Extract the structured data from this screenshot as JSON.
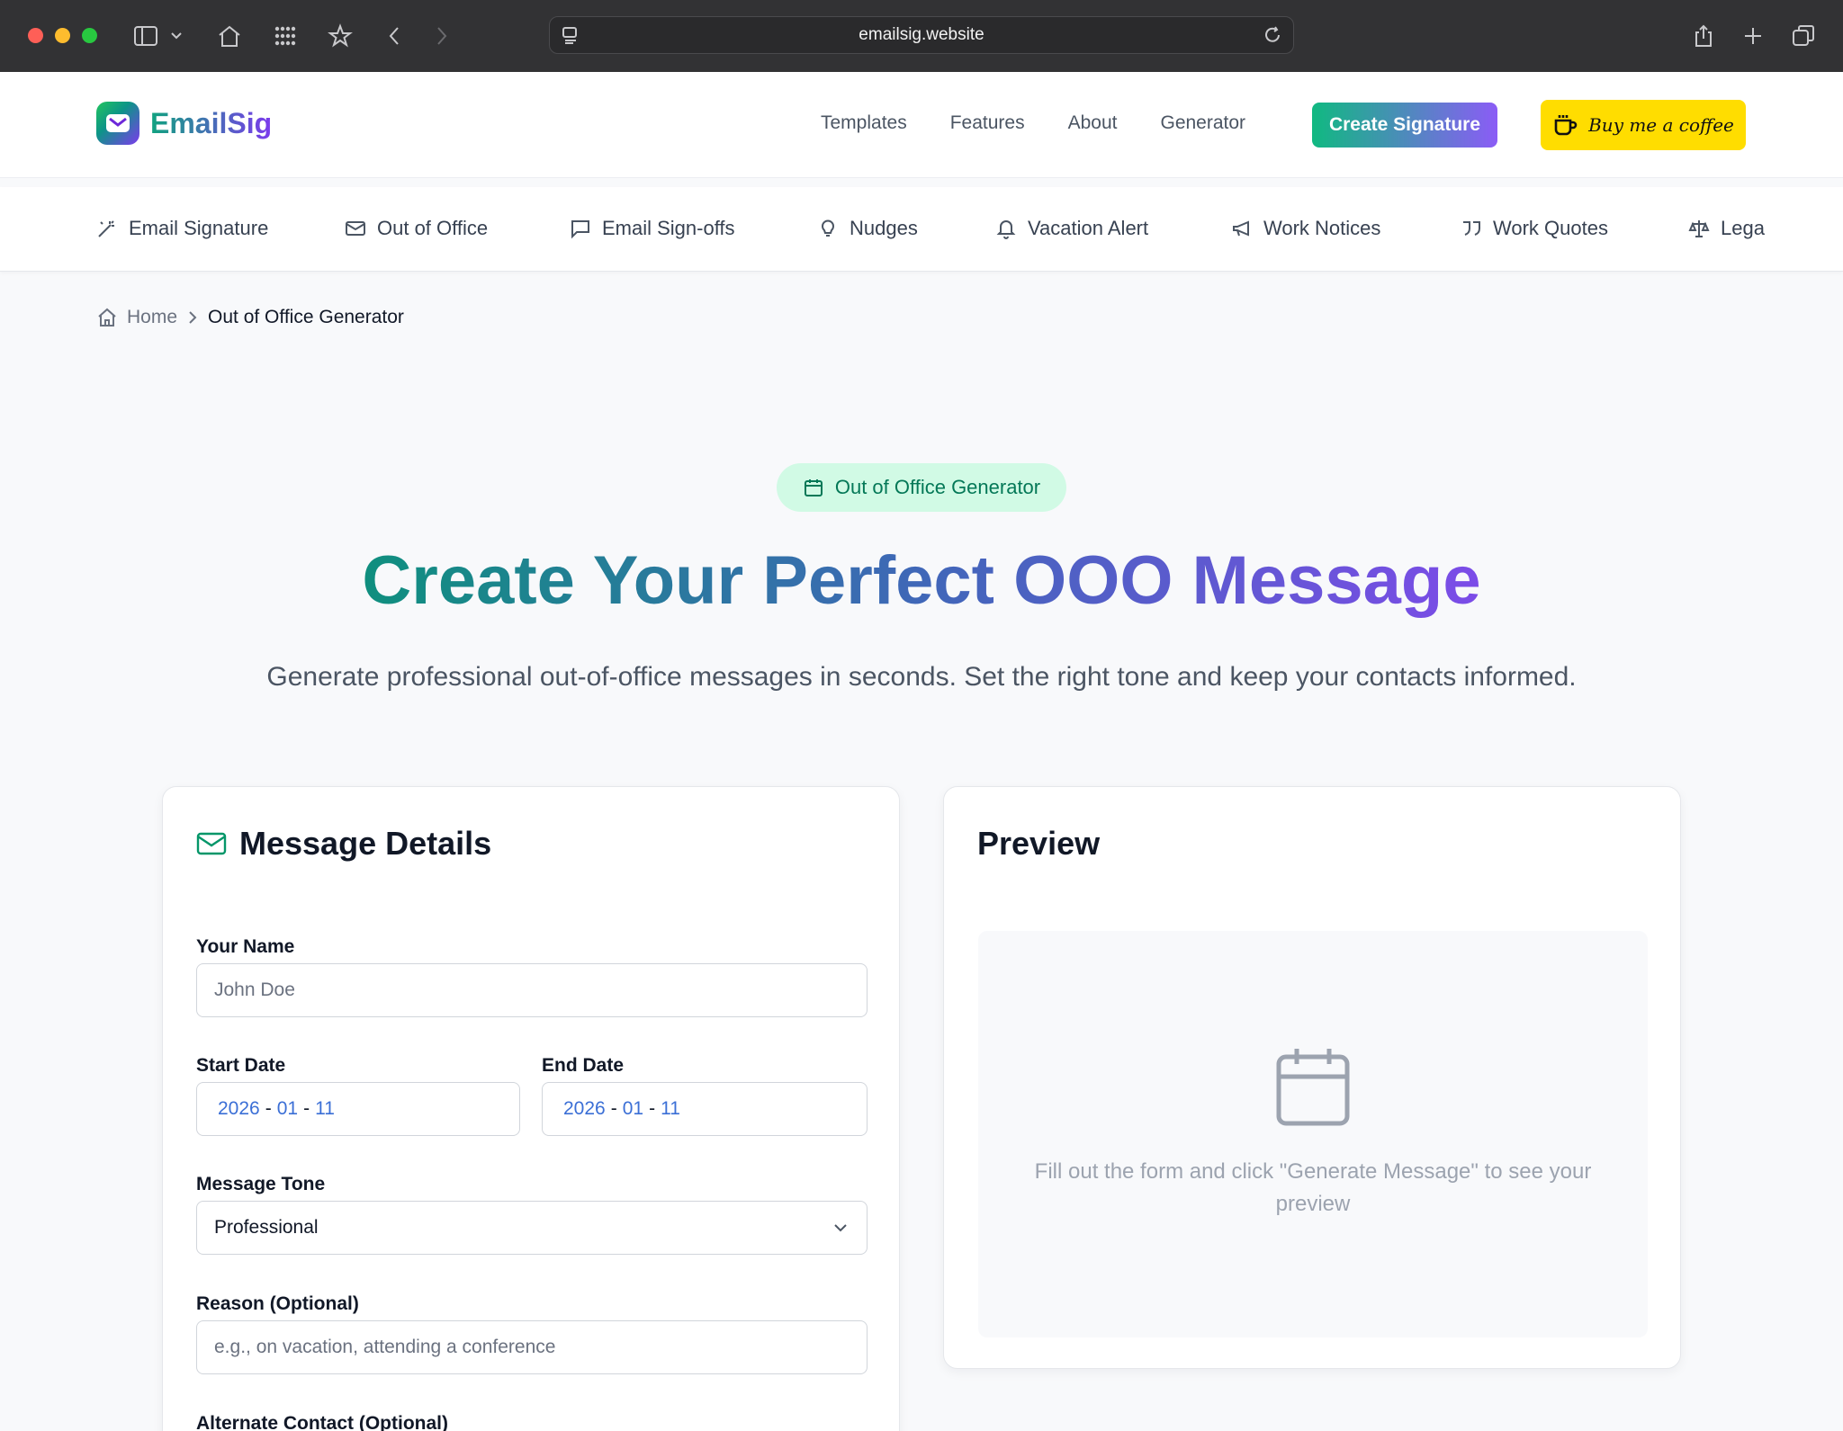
{
  "browser": {
    "url": "emailsig.website"
  },
  "header": {
    "logo_text": "EmailSig",
    "nav": [
      "Templates",
      "Features",
      "About",
      "Generator"
    ],
    "create_button": "Create Signature",
    "coffee_button": "Buy me a coffee"
  },
  "categories": [
    {
      "label": "Email Signature",
      "icon": "wand-icon"
    },
    {
      "label": "Out of Office",
      "icon": "mail-icon"
    },
    {
      "label": "Email Sign-offs",
      "icon": "chat-icon"
    },
    {
      "label": "Nudges",
      "icon": "lightbulb-icon"
    },
    {
      "label": "Vacation Alert",
      "icon": "bell-icon"
    },
    {
      "label": "Work Notices",
      "icon": "megaphone-icon"
    },
    {
      "label": "Work Quotes",
      "icon": "quote-icon"
    },
    {
      "label": "Lega",
      "icon": "scale-icon"
    }
  ],
  "breadcrumb": {
    "home": "Home",
    "current": "Out of Office Generator"
  },
  "hero": {
    "badge": "Out of Office Generator",
    "title": "Create Your Perfect OOO Message",
    "subtitle": "Generate professional out-of-office messages in seconds. Set the right tone and keep your contacts informed."
  },
  "form": {
    "title": "Message Details",
    "name_label": "Your Name",
    "name_placeholder": "John Doe",
    "start_label": "Start Date",
    "start_date": {
      "year": "2026",
      "month": "01",
      "day": "11"
    },
    "end_label": "End Date",
    "end_date": {
      "year": "2026",
      "month": "01",
      "day": "11"
    },
    "tone_label": "Message Tone",
    "tone_value": "Professional",
    "reason_label": "Reason (Optional)",
    "reason_placeholder": "e.g., on vacation, attending a conference",
    "alt_contact_label": "Alternate Contact (Optional)"
  },
  "preview": {
    "title": "Preview",
    "empty_text": "Fill out the form and click \"Generate Message\" to see your preview"
  },
  "colors": {
    "accent_green": "#10b981",
    "accent_purple": "#8b5cf6",
    "coffee_yellow": "#ffdd00"
  }
}
